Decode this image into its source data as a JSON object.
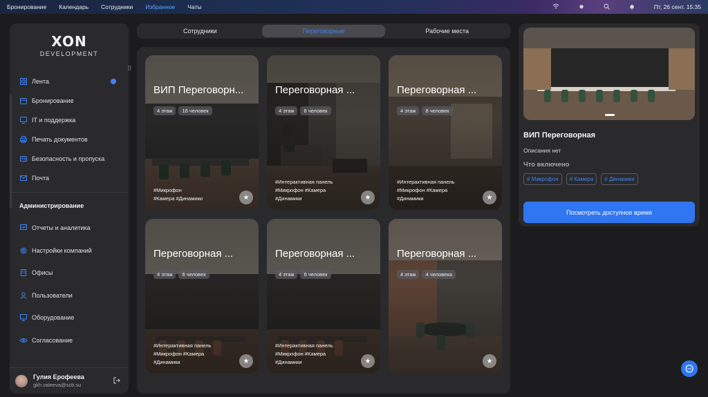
{
  "topbar": {
    "menu": [
      {
        "label": "Бронирование"
      },
      {
        "label": "Календарь"
      },
      {
        "label": "Сотрудники"
      },
      {
        "label": "Избранное",
        "active": true
      },
      {
        "label": "Чаты"
      }
    ],
    "datetime": "Пт, 26 сент. 15:35"
  },
  "logo": {
    "mark": "XON",
    "sub": "DEVELOPMENT"
  },
  "sidebar": {
    "items": [
      {
        "label": "Лента",
        "icon": "grid-icon"
      },
      {
        "label": "Бронирование",
        "icon": "calendar-icon"
      },
      {
        "label": "IT и поддержка",
        "icon": "support-icon"
      },
      {
        "label": "Печать документов",
        "icon": "printer-icon"
      },
      {
        "label": "Безопасность и пропуска",
        "icon": "id-card-icon"
      },
      {
        "label": "Почта",
        "icon": "mail-icon"
      }
    ],
    "admin_title": "Администрирование",
    "admin_items": [
      {
        "label": "Отчеты и аналитика",
        "icon": "chart-icon"
      },
      {
        "label": "Настройки компаний",
        "icon": "gear-icon"
      },
      {
        "label": "Офисы",
        "icon": "building-icon"
      },
      {
        "label": "Пользователи",
        "icon": "user-icon"
      },
      {
        "label": "Оборудование",
        "icon": "monitor-icon"
      },
      {
        "label": "Согласование",
        "icon": "approval-icon"
      }
    ],
    "user": {
      "name": "Гулия Ерофеева",
      "email": "gkh.valeeva@scb.su"
    }
  },
  "tabs": [
    {
      "label": "Сотрудники"
    },
    {
      "label": "Переговорные",
      "active": true
    },
    {
      "label": "Рабочие места"
    }
  ],
  "cards": [
    {
      "title": "ВИП Переговорн...",
      "floor": "4 этаж",
      "people": "16 человек",
      "tags": "#Микрофон\n#Камера #Динамики"
    },
    {
      "title": "Переговорная ...",
      "floor": "4 этаж",
      "people": "8 человек",
      "tags": "#Интерактивная панель\n#Микрофон #Камера\n#Динамики"
    },
    {
      "title": "Переговорная ...",
      "floor": "4 этаж",
      "people": "8 человек",
      "tags": "#Интерактивная панель\n#Микрофон #Камера\n#Динамики"
    },
    {
      "title": "Переговорная ...",
      "floor": "4 этаж",
      "people": "6 человек",
      "tags": "#Интерактивная панель\n#Микрофон #Камера\n#Динамики"
    },
    {
      "title": "Переговорная ...",
      "floor": "4 этаж",
      "people": "6 человек",
      "tags": "#Интерактивная панель\n#Микрофон #Камера\n#Динамики"
    },
    {
      "title": "Переговорная ...",
      "floor": "4 этаж",
      "people": "4 человека",
      "tags": ""
    }
  ],
  "detail": {
    "title": "ВИП Переговорная",
    "description": "Описания нет",
    "included_label": "Что включено",
    "tags": [
      "# Микрофон",
      "# Камера",
      "# Динамики"
    ],
    "cta": "Посмотреть доступное время"
  },
  "colors": {
    "accent": "#2f76f0",
    "panel": "#2a2a2d",
    "background": "#1c1c1e"
  }
}
